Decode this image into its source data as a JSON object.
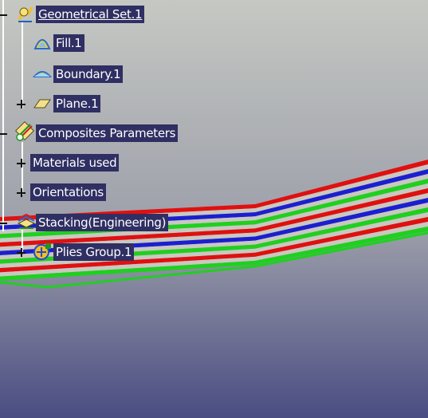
{
  "colors": {
    "background_top": "#c5c8c2",
    "background_bottom": "#4a4d82",
    "label_bg": "#2f2f63",
    "ply_red": "#e01010",
    "ply_blue": "#1b1fd0",
    "ply_green": "#1fd01f",
    "ply_grey": "#c9c8c0"
  },
  "tree": {
    "nodes": [
      {
        "label": "Geometrical Set.1",
        "icon": "geometrical-set-icon",
        "expander": "minus"
      },
      {
        "label": "Fill.1",
        "icon": "fill-surface-icon",
        "expander": ""
      },
      {
        "label": "Boundary.1",
        "icon": "boundary-curve-icon",
        "expander": ""
      },
      {
        "label": "Plane.1",
        "icon": "plane-icon",
        "expander": "plus"
      },
      {
        "label": "Composites Parameters",
        "icon": "composites-parameters-icon",
        "expander": "minus"
      },
      {
        "label": "Materials used",
        "icon": "",
        "expander": "plus"
      },
      {
        "label": "Orientations",
        "icon": "",
        "expander": "plus"
      },
      {
        "label": "Stacking(Engineering)",
        "icon": "stacking-icon",
        "expander": "minus"
      },
      {
        "label": "Plies Group.1",
        "icon": "plies-group-icon",
        "expander": "plus"
      }
    ]
  }
}
